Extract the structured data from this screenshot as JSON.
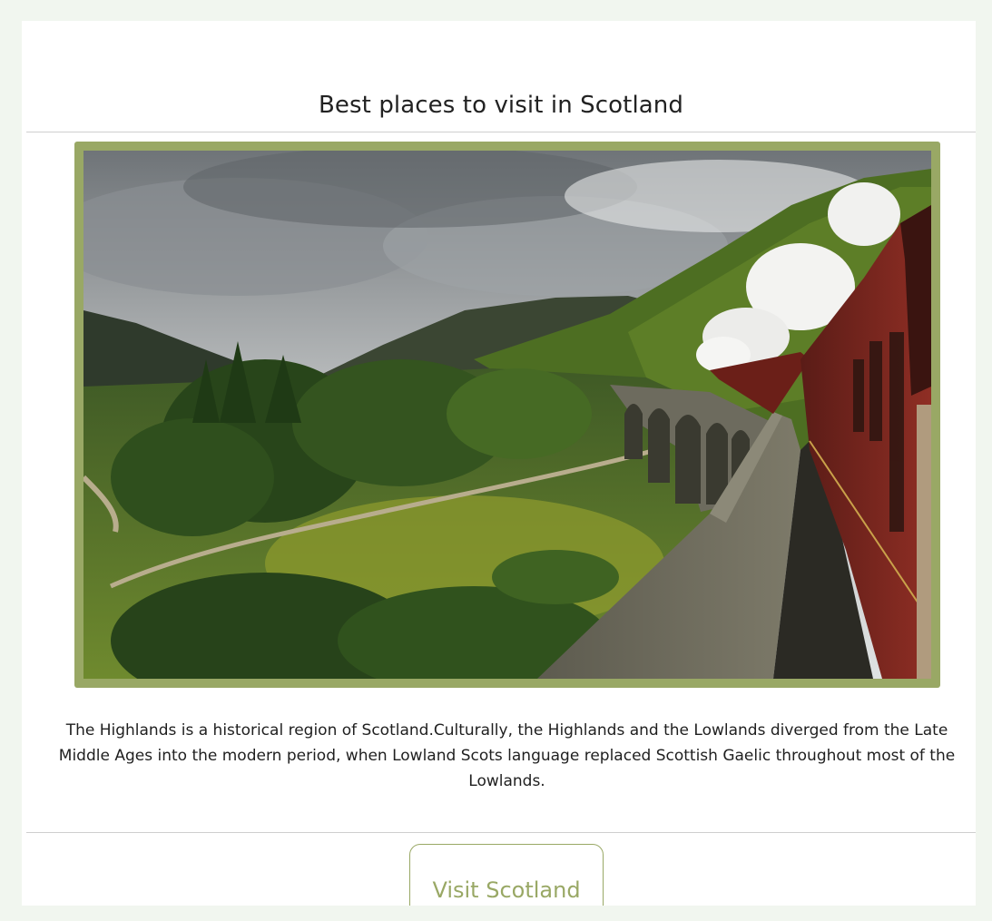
{
  "page": {
    "title": "Best places to visit in Scotland"
  },
  "image": {
    "alt": "Steam train crossing the Glenfinnan Viaduct in the Scottish Highlands"
  },
  "description": "The Highlands is a historical region of Scotland.Culturally, the Highlands and the Lowlands diverged from the Late Middle Ages into the modern period, when Lowland Scots language replaced Scottish Gaelic throughout most of the Lowlands.",
  "button": {
    "label": "Visit Scotland"
  },
  "colors": {
    "page_background": "#f1f6ef",
    "accent": "#99a865",
    "text": "#222222"
  }
}
